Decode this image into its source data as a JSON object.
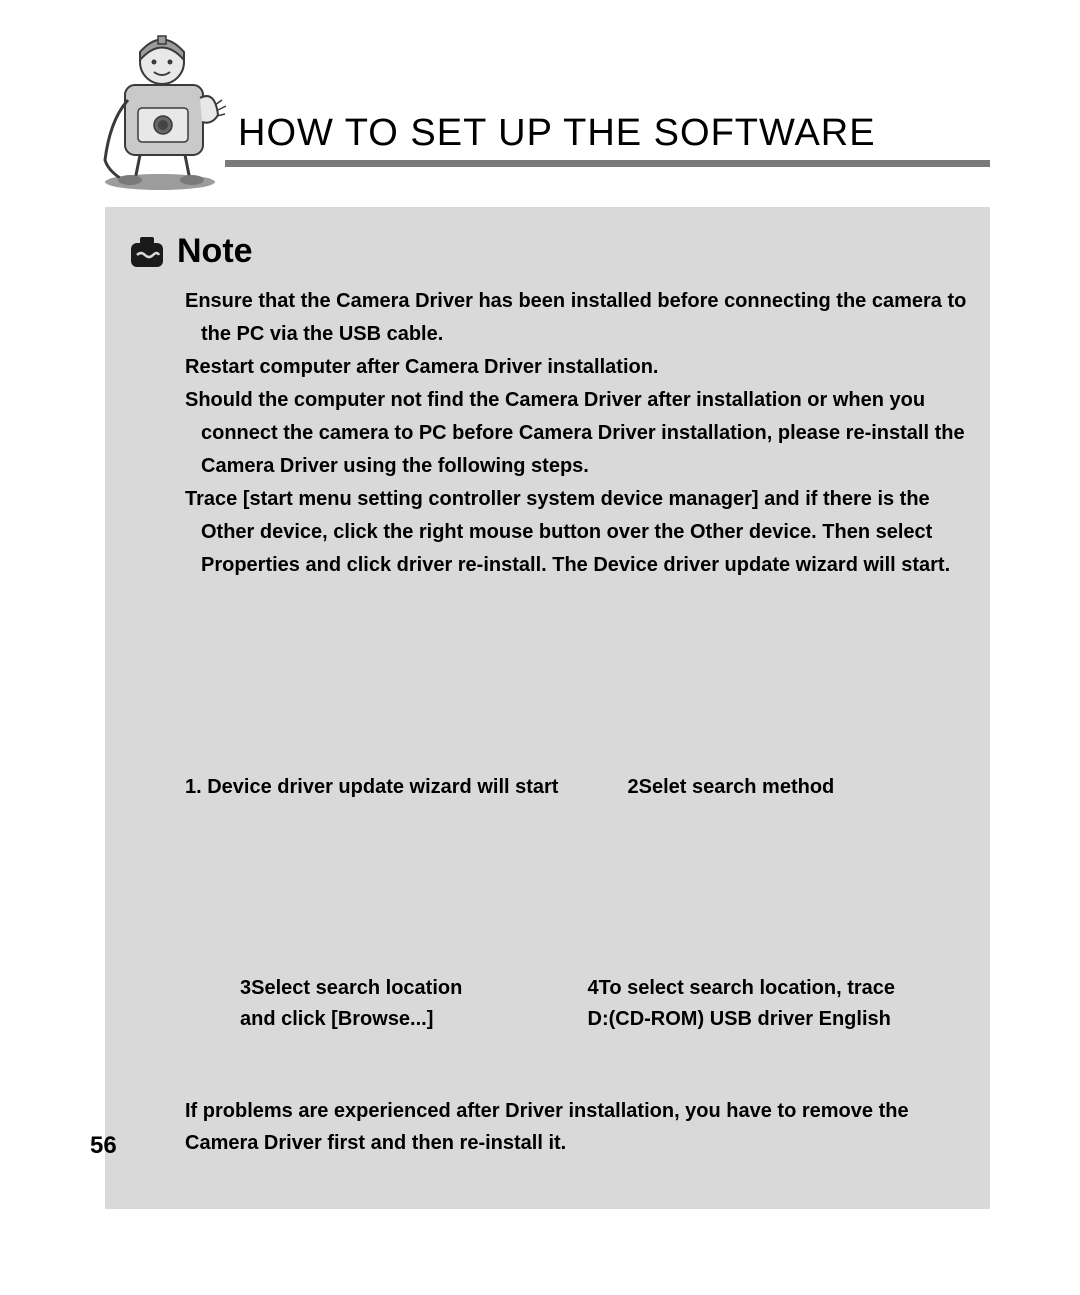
{
  "header": {
    "title": "HOW TO SET UP THE SOFTWARE"
  },
  "note": {
    "label": "Note",
    "paragraphs": [
      "Ensure that the Camera Driver has been installed before connecting the camera to the PC via the USB cable.",
      "Restart computer after  Camera Driver installation.",
      "Should the computer not find the Camera Driver after installation or when you connect the camera to PC before Camera Driver installation, please re-install the  Camera Driver using the following steps.",
      "Trace [start menu    setting     controller    system     device manager] and if there is the Other device, click the right mouse button over the Other device. Then select Properties and click driver re-install. The Device driver update wizard will start."
    ]
  },
  "steps": {
    "s1": "1. Device driver update wizard will start",
    "s2": "2Selet search method",
    "s3a": "3Select search location",
    "s3b": "and click [Browse...]",
    "s4a": "4To select search location, trace",
    "s4b": "D:(CD-ROM)    USB driver     English"
  },
  "final": "If problems are experienced after Driver installation, you have to remove the Camera Driver first and then re-install it.",
  "pageNumber": "56"
}
